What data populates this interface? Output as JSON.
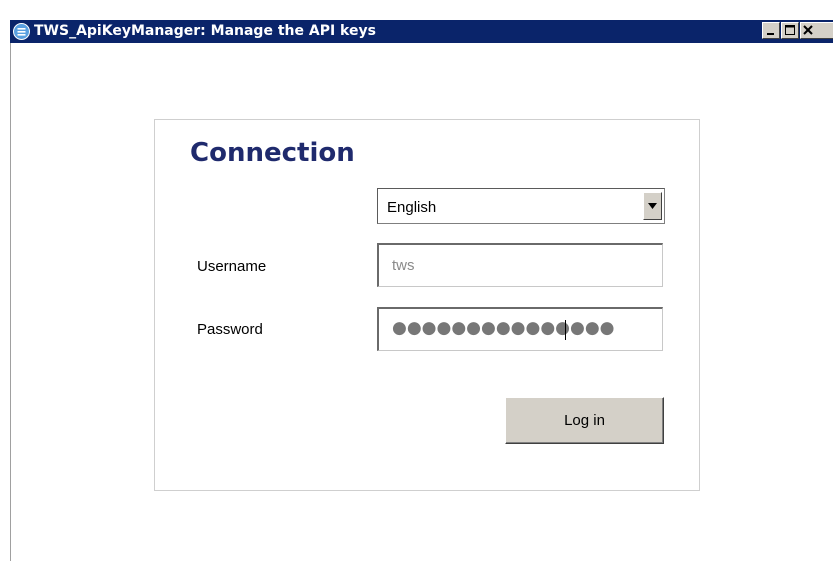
{
  "window": {
    "title": "TWS_ApiKeyManager: Manage the API keys",
    "controls": [
      "minimize-icon",
      "maximize-icon",
      "close-icon"
    ],
    "titlebar_color": "#0a246a"
  },
  "form": {
    "heading": "Connection",
    "heading_color": "#1f2a6d",
    "language": {
      "selected": "English"
    },
    "username": {
      "label": "Username",
      "value": "tws"
    },
    "password": {
      "label": "Password",
      "masked": "●●●●●●●●●●●●●●●"
    },
    "login_label": "Log in"
  }
}
